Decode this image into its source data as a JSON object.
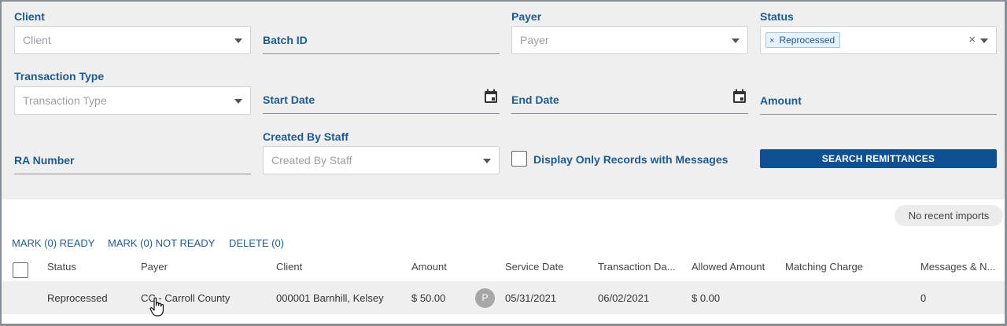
{
  "filters": {
    "client": {
      "label": "Client",
      "placeholder": "Client"
    },
    "batch_id": {
      "label": "Batch ID"
    },
    "payer": {
      "label": "Payer",
      "placeholder": "Payer"
    },
    "status": {
      "label": "Status",
      "chip_label": "Reprocessed",
      "chip_remove": "×",
      "clear": "×"
    },
    "transaction_type": {
      "label": "Transaction Type",
      "placeholder": "Transaction Type"
    },
    "start_date": {
      "label": "Start Date"
    },
    "end_date": {
      "label": "End Date"
    },
    "amount": {
      "label": "Amount"
    },
    "ra_number": {
      "label": "RA Number"
    },
    "created_by_staff": {
      "label": "Created By Staff",
      "placeholder": "Created By Staff"
    },
    "messages_only": {
      "label": "Display Only Records with Messages",
      "checked": false
    },
    "search_button": "SEARCH REMITTANCES"
  },
  "imports_badge": "No recent imports",
  "actions": {
    "mark_ready": "MARK (0) READY",
    "mark_not_ready": "MARK (0) NOT READY",
    "delete": "DELETE (0)"
  },
  "table": {
    "headers": [
      "Status",
      "Payer",
      "Client",
      "Amount",
      "Service Date",
      "Transaction Da...",
      "Allowed Amount",
      "Matching Charge",
      "Messages & N..."
    ],
    "rows": [
      {
        "status": "Reprocessed",
        "payer": "CC - Carroll County",
        "client": "000001 Barnhill, Kelsey",
        "amount": "$ 50.00",
        "badge": "P",
        "service_date": "05/31/2021",
        "transaction_date": "06/02/2021",
        "allowed_amount": "$ 0.00",
        "matching_charge": "",
        "messages": "0"
      }
    ]
  },
  "icons": {
    "dropdown": "chevron-down-icon",
    "calendar": "calendar-icon",
    "cursor": "hand-pointer-icon"
  }
}
